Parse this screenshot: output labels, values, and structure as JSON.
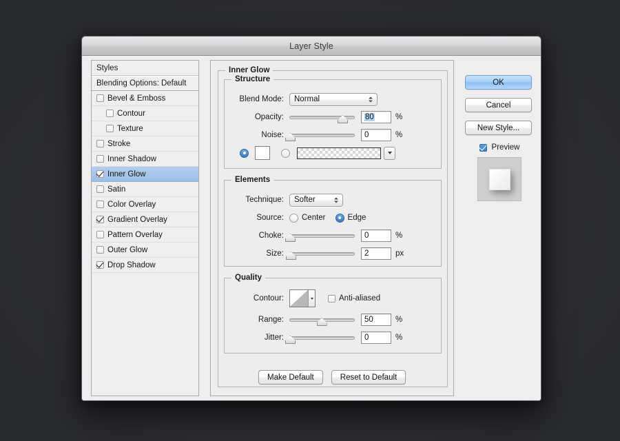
{
  "window": {
    "title": "Layer Style"
  },
  "sidebar": {
    "header": "Styles",
    "blending_options": "Blending Options: Default",
    "items": [
      {
        "label": "Bevel & Emboss",
        "checked": false,
        "indent": false,
        "selected": false
      },
      {
        "label": "Contour",
        "checked": false,
        "indent": true,
        "selected": false
      },
      {
        "label": "Texture",
        "checked": false,
        "indent": true,
        "selected": false
      },
      {
        "label": "Stroke",
        "checked": false,
        "indent": false,
        "selected": false
      },
      {
        "label": "Inner Shadow",
        "checked": false,
        "indent": false,
        "selected": false
      },
      {
        "label": "Inner Glow",
        "checked": true,
        "indent": false,
        "selected": true
      },
      {
        "label": "Satin",
        "checked": false,
        "indent": false,
        "selected": false
      },
      {
        "label": "Color Overlay",
        "checked": false,
        "indent": false,
        "selected": false
      },
      {
        "label": "Gradient Overlay",
        "checked": true,
        "indent": false,
        "selected": false
      },
      {
        "label": "Pattern Overlay",
        "checked": false,
        "indent": false,
        "selected": false
      },
      {
        "label": "Outer Glow",
        "checked": false,
        "indent": false,
        "selected": false
      },
      {
        "label": "Drop Shadow",
        "checked": true,
        "indent": false,
        "selected": false
      }
    ]
  },
  "panel": {
    "title": "Inner Glow",
    "structure": {
      "legend": "Structure",
      "blend_mode_label": "Blend Mode:",
      "blend_mode_value": "Normal",
      "opacity_label": "Opacity:",
      "opacity_value": "80",
      "opacity_unit": "%",
      "opacity_percent": 80,
      "noise_label": "Noise:",
      "noise_value": "0",
      "noise_unit": "%",
      "noise_percent": 0,
      "fill_color_selected": true,
      "fill_gradient_selected": false,
      "color_swatch": "#ffffff"
    },
    "elements": {
      "legend": "Elements",
      "technique_label": "Technique:",
      "technique_value": "Softer",
      "source_label": "Source:",
      "source_center_label": "Center",
      "source_edge_label": "Edge",
      "source_selected": "Edge",
      "choke_label": "Choke:",
      "choke_value": "0",
      "choke_unit": "%",
      "choke_percent": 0,
      "size_label": "Size:",
      "size_value": "2",
      "size_unit": "px",
      "size_percent": 1
    },
    "quality": {
      "legend": "Quality",
      "contour_label": "Contour:",
      "anti_aliased_label": "Anti-aliased",
      "anti_aliased_checked": false,
      "range_label": "Range:",
      "range_value": "50",
      "range_unit": "%",
      "range_percent": 48,
      "jitter_label": "Jitter:",
      "jitter_value": "0",
      "jitter_unit": "%",
      "jitter_percent": 0
    },
    "make_default_label": "Make Default",
    "reset_to_default_label": "Reset to Default"
  },
  "actions": {
    "ok_label": "OK",
    "cancel_label": "Cancel",
    "new_style_label": "New Style...",
    "preview_label": "Preview",
    "preview_checked": true
  },
  "colors": {
    "accent_selection": "#9dbfe6",
    "default_button": "#8cbdf2",
    "dialog_bg": "#ededed",
    "desktop_bg": "#2b2b30"
  }
}
